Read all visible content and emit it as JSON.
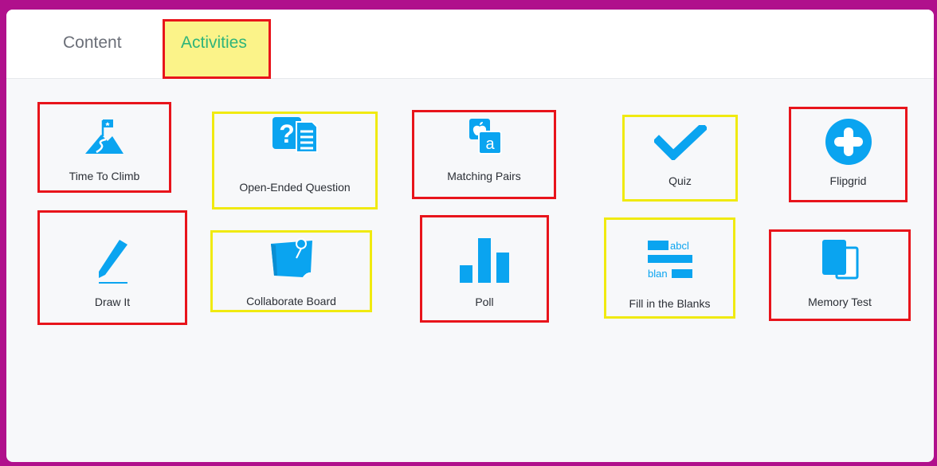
{
  "tabs": [
    {
      "label": "Content",
      "active": false
    },
    {
      "label": "Activities",
      "active": true
    }
  ],
  "activities": [
    {
      "label": "Time To Climb",
      "icon": "mountain-flag-icon"
    },
    {
      "label": "Open-Ended Question",
      "icon": "question-doc-icon"
    },
    {
      "label": "Matching Pairs",
      "icon": "matching-pairs-icon"
    },
    {
      "label": "Quiz",
      "icon": "checkmark-icon"
    },
    {
      "label": "Flipgrid",
      "icon": "plus-circle-icon"
    },
    {
      "label": "Draw It",
      "icon": "pencil-icon"
    },
    {
      "label": "Collaborate Board",
      "icon": "pinned-board-icon"
    },
    {
      "label": "Poll",
      "icon": "bar-chart-icon"
    },
    {
      "label": "Fill in the Blanks",
      "icon": "fill-blanks-icon"
    },
    {
      "label": "Memory Test",
      "icon": "cards-icon"
    }
  ],
  "fill_blanks_icon_text": [
    "abcl",
    "blan"
  ],
  "matching_icon_letter": "a",
  "colors": {
    "frame": "#b0108c",
    "accent": "#0aa4f0",
    "active_tab": "#2fb47a",
    "highlight_red": "#e8141b",
    "highlight_yellow": "#f0ea10",
    "tab_highlight_fill": "#fbf389"
  }
}
